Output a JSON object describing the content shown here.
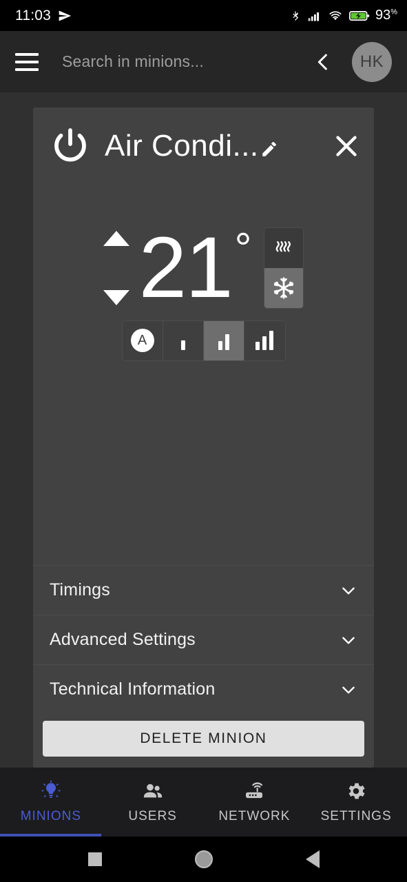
{
  "status_bar": {
    "time": "11:03",
    "send_icon": "send-icon",
    "bluetooth_icon": "bluetooth-icon",
    "signal_icon": "cellular-signal-icon",
    "wifi_icon": "wifi-icon",
    "battery_icon": "battery-charging-icon",
    "battery_percent": "93",
    "percent_symbol": "%"
  },
  "app_bar": {
    "menu_icon": "hamburger-menu-icon",
    "search_placeholder": "Search in minions...",
    "search_value": "",
    "back_icon": "chevron-left-icon",
    "avatar_initials": "HK"
  },
  "minion_card": {
    "power_icon": "power-icon",
    "title": "Air Condi...",
    "edit_icon": "pencil-edit-icon",
    "close_icon": "close-icon",
    "thermostat": {
      "increase_icon": "triangle-up-icon",
      "decrease_icon": "triangle-down-icon",
      "temperature": "21",
      "degree_symbol": "°",
      "modes": [
        {
          "name": "heat",
          "icon": "heat-waves-icon",
          "active": false
        },
        {
          "name": "cool",
          "icon": "snowflake-icon",
          "active": true
        }
      ]
    },
    "fan_speeds": [
      {
        "name": "auto",
        "label": "A",
        "icon": "auto-circle-icon",
        "active": false
      },
      {
        "name": "low",
        "icon": "signal-bars-1-icon",
        "active": false
      },
      {
        "name": "medium",
        "icon": "signal-bars-2-icon",
        "active": true
      },
      {
        "name": "high",
        "icon": "signal-bars-3-icon",
        "active": false
      }
    ],
    "sections": [
      {
        "label": "Timings",
        "chevron": "chevron-down-icon"
      },
      {
        "label": "Advanced Settings",
        "chevron": "chevron-down-icon"
      },
      {
        "label": "Technical Information",
        "chevron": "chevron-down-icon"
      }
    ],
    "delete_label": "DELETE MINION"
  },
  "bottom_nav": {
    "active_color": "#4a5bd4",
    "items": [
      {
        "label": "MINIONS",
        "icon": "lightbulb-icon",
        "active": true
      },
      {
        "label": "USERS",
        "icon": "people-icon",
        "active": false
      },
      {
        "label": "NETWORK",
        "icon": "router-icon",
        "active": false
      },
      {
        "label": "SETTINGS",
        "icon": "gear-icon",
        "active": false
      }
    ]
  },
  "android_nav": {
    "recents_icon": "square-recents-icon",
    "home_icon": "circle-home-icon",
    "back_icon": "triangle-back-icon"
  }
}
